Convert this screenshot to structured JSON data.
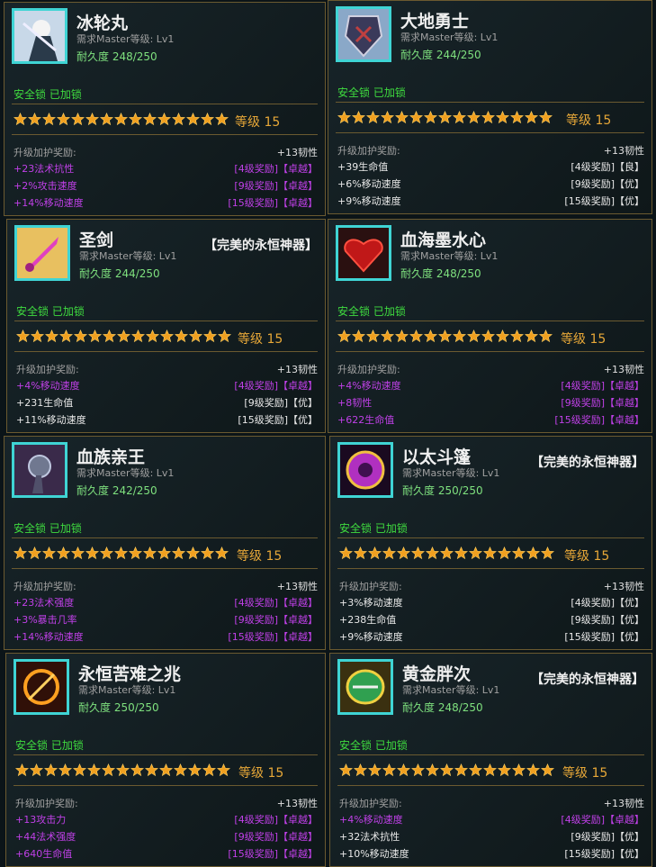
{
  "common": {
    "lock_text": "安全锁 已加锁",
    "bonus_header": "升级加护奖励:",
    "bonus_value": "+13韧性",
    "level_text": "等级 15",
    "stars": 15
  },
  "cards": [
    {
      "name": "冰轮丸",
      "perfect": "",
      "req": "需求Master等级: Lv1",
      "durability": "耐久度 248/250",
      "rows": [
        {
          "stat": "+23法术抗性",
          "tier": "[4级奖励]【卓越】",
          "style": "purple"
        },
        {
          "stat": "+2%攻击速度",
          "tier": "[9级奖励]【卓越】",
          "style": "purple"
        },
        {
          "stat": "+14%移动速度",
          "tier": "[15级奖励]【卓越】",
          "style": "purple"
        }
      ]
    },
    {
      "name": "大地勇士",
      "perfect": "",
      "req": "需求Master等级: Lv1",
      "durability": "耐久度 244/250",
      "rows": [
        {
          "stat": "+39生命值",
          "tier": "[4级奖励]【良】",
          "style": "white"
        },
        {
          "stat": "+6%移动速度",
          "tier": "[9级奖励]【优】",
          "style": "white"
        },
        {
          "stat": "+9%移动速度",
          "tier": "[15级奖励]【优】",
          "style": "white"
        }
      ]
    },
    {
      "name": "圣剑",
      "perfect": "【完美的永恒神器】",
      "req": "需求Master等级: Lv1",
      "durability": "耐久度 244/250",
      "rows": [
        {
          "stat": "+4%移动速度",
          "tier": "[4级奖励]【卓越】",
          "style": "purple"
        },
        {
          "stat": "+231生命值",
          "tier": "[9级奖励]【优】",
          "style": "white"
        },
        {
          "stat": "+11%移动速度",
          "tier": "[15级奖励]【优】",
          "style": "white"
        }
      ]
    },
    {
      "name": "血海墨水心",
      "perfect": "",
      "req": "需求Master等级: Lv1",
      "durability": "耐久度 248/250",
      "rows": [
        {
          "stat": "+4%移动速度",
          "tier": "[4级奖励]【卓越】",
          "style": "purple"
        },
        {
          "stat": "+8韧性",
          "tier": "[9级奖励]【卓越】",
          "style": "purple"
        },
        {
          "stat": "+622生命值",
          "tier": "[15级奖励]【卓越】",
          "style": "purple"
        }
      ]
    },
    {
      "name": "血族亲王",
      "perfect": "",
      "req": "需求Master等级: Lv1",
      "durability": "耐久度 242/250",
      "rows": [
        {
          "stat": "+23法术强度",
          "tier": "[4级奖励]【卓越】",
          "style": "purple"
        },
        {
          "stat": "+3%暴击几率",
          "tier": "[9级奖励]【卓越】",
          "style": "purple"
        },
        {
          "stat": "+14%移动速度",
          "tier": "[15级奖励]【卓越】",
          "style": "purple"
        }
      ]
    },
    {
      "name": "以太斗篷",
      "perfect": "【完美的永恒神器】",
      "req": "需求Master等级: Lv1",
      "durability": "耐久度 250/250",
      "rows": [
        {
          "stat": "+3%移动速度",
          "tier": "[4级奖励]【优】",
          "style": "white"
        },
        {
          "stat": "+238生命值",
          "tier": "[9级奖励]【优】",
          "style": "white"
        },
        {
          "stat": "+9%移动速度",
          "tier": "[15级奖励]【优】",
          "style": "white"
        }
      ]
    },
    {
      "name": "永恒苦难之兆",
      "perfect": "",
      "req": "需求Master等级: Lv1",
      "durability": "耐久度 250/250",
      "rows": [
        {
          "stat": "+13攻击力",
          "tier": "[4级奖励]【卓越】",
          "style": "purple"
        },
        {
          "stat": "+44法术强度",
          "tier": "[9级奖励]【卓越】",
          "style": "purple"
        },
        {
          "stat": "+640生命值",
          "tier": "[15级奖励]【卓越】",
          "style": "purple"
        }
      ]
    },
    {
      "name": "黄金胖次",
      "perfect": "【完美的永恒神器】",
      "req": "需求Master等级: Lv1",
      "durability": "耐久度 248/250",
      "rows": [
        {
          "stat": "+4%移动速度",
          "tier": "[4级奖励]【卓越】",
          "style": "purple"
        },
        {
          "stat": "+32法术抗性",
          "tier": "[9级奖励]【优】",
          "style": "white"
        },
        {
          "stat": "+10%移动速度",
          "tier": "[15级奖励]【优】",
          "style": "white"
        }
      ]
    }
  ]
}
